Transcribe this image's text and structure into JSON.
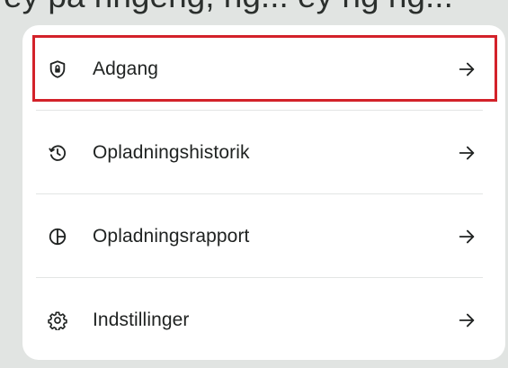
{
  "cropped_header_text": "ey på ringeng, ng... ey ng ng...",
  "menu": {
    "items": [
      {
        "label": "Adgang",
        "icon": "shield-lock-icon"
      },
      {
        "label": "Opladningshistorik",
        "icon": "history-icon"
      },
      {
        "label": "Opladningsrapport",
        "icon": "pie-chart-icon"
      },
      {
        "label": "Indstillinger",
        "icon": "gear-icon"
      }
    ],
    "arrow_icon": "arrow-right-icon"
  },
  "colors": {
    "highlight": "#d3222a",
    "text": "#202322",
    "background": "#e1e4e2",
    "card": "#ffffff"
  }
}
